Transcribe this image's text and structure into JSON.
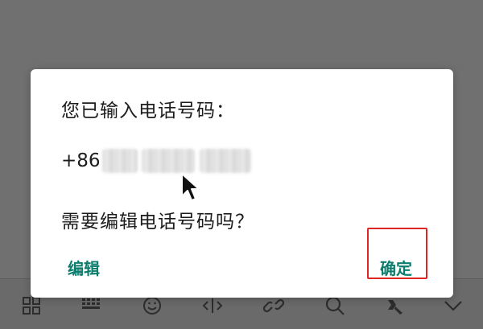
{
  "dialog": {
    "title": "您已输入电话号码：",
    "phone_prefix": "+86",
    "question": "需要编辑电话号码吗？",
    "edit_button": "编辑",
    "confirm_button": "确定"
  },
  "colors": {
    "accent": "#0c7d6c",
    "highlight_box": "#e02525",
    "scrim": "#707070"
  },
  "toolbar": {
    "icons": [
      "grid-icon",
      "keyboard-icon",
      "emoji-icon",
      "cursor-move-icon",
      "link-icon",
      "search-icon",
      "settings-icon",
      "chevron-down-icon"
    ]
  }
}
